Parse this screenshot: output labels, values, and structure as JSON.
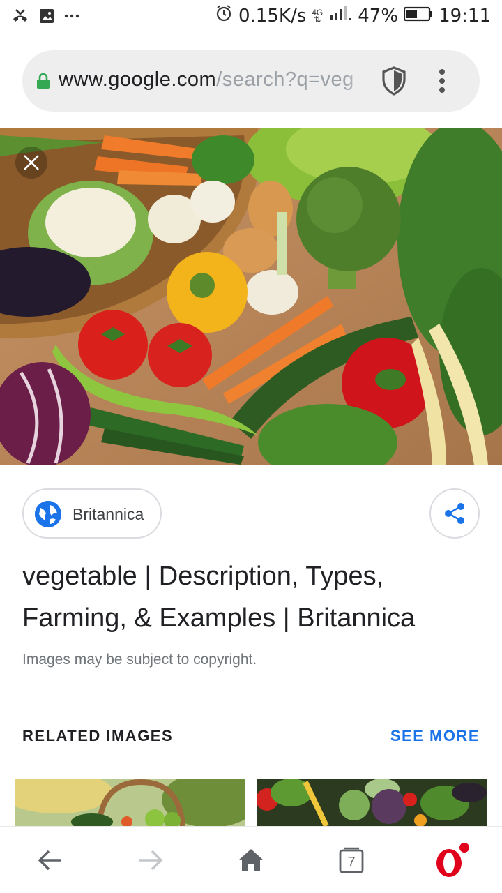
{
  "status_bar": {
    "net_speed": "0.15K/s",
    "net_type": "4G",
    "battery": "47%",
    "time": "19:11"
  },
  "address_bar": {
    "url_domain": "www.google.com",
    "url_path": "/search?q=veg"
  },
  "result": {
    "source": "Britannica",
    "title": "vegetable | Description, Types, Farming, & Examples | Britannica",
    "copyright_note": "Images may be subject to copyright."
  },
  "related": {
    "heading": "RELATED IMAGES",
    "see_more": "SEE MORE"
  },
  "bottom_nav": {
    "tab_count": "7"
  },
  "colors": {
    "accent": "#1a73e8",
    "lock_green": "#34a853",
    "opera_red": "#e0001b"
  }
}
